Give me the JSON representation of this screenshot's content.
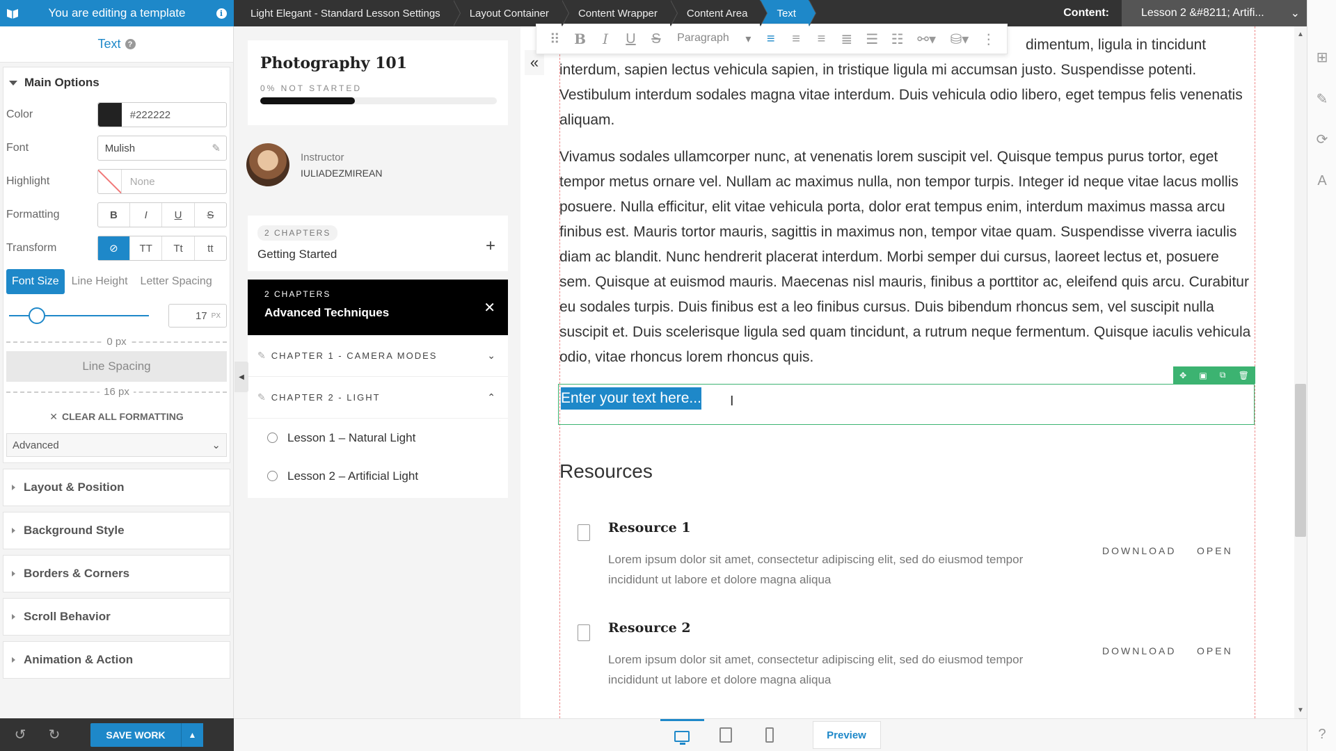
{
  "topbar": {
    "editing_label": "You are editing a template",
    "breadcrumbs": [
      "Light Elegant - Standard Lesson Settings",
      "Layout Container",
      "Content Wrapper",
      "Content Area",
      "Text"
    ],
    "content_label": "Content:",
    "content_value": "Lesson 2 &#8211; Artifi...",
    "accent": "#1e88c9"
  },
  "left_panel": {
    "title": "Text",
    "main_options_label": "Main Options",
    "color_label": "Color",
    "color_value": "#222222",
    "font_label": "Font",
    "font_value": "Mulish",
    "highlight_label": "Highlight",
    "highlight_value": "None",
    "formatting_label": "Formatting",
    "formatting_buttons": [
      "B",
      "I",
      "U",
      "S"
    ],
    "transform_label": "Transform",
    "transform_buttons": [
      "⊘",
      "TT",
      "Tt",
      "tt"
    ],
    "size_tabs": [
      "Font Size",
      "Line Height",
      "Letter Spacing"
    ],
    "font_size_value": "17",
    "font_size_unit": "PX",
    "spacing_top": "0 px",
    "line_spacing_label": "Line Spacing",
    "spacing_bottom": "16 px",
    "clear_formatting": "CLEAR ALL FORMATTING",
    "advanced_label": "Advanced",
    "sections": [
      "Layout & Position",
      "Background Style",
      "Borders & Corners",
      "Scroll Behavior",
      "Animation & Action"
    ],
    "save_label": "SAVE WORK"
  },
  "course": {
    "title": "Photography 101",
    "progress_text": "0% NOT STARTED",
    "progress_fraction": 0.4,
    "instructor_role": "Instructor",
    "instructor_name": "IULIADEZMIREAN",
    "chapter1_count": "2 CHAPTERS",
    "chapter1_name": "Getting Started",
    "chapter2_count": "2 CHAPTERS",
    "chapter2_name": "Advanced Techniques",
    "sub_chapters": [
      "CHAPTER 1 - CAMERA MODES",
      "CHAPTER 2 - LIGHT"
    ],
    "lessons": [
      "Lesson 1 – Natural Light",
      "Lesson 2 – Artificial Light"
    ]
  },
  "editor": {
    "toolbar_paragraph": "Paragraph",
    "para1": "dimentum, ligula in tincidunt interdum, sapien lectus vehicula sapien, in tristique ligula mi accumsan justo. Suspendisse potenti. Vestibulum interdum sodales magna vitae interdum. Duis vehicula odio libero, eget tempus felis venenatis aliquam.",
    "para2": "Vivamus sodales ullamcorper nunc, at venenatis lorem suscipit vel. Quisque tempus purus tortor, eget tempor metus ornare vel. Nullam ac maximus nulla, non tempor turpis. Integer id neque vitae lacus mollis posuere. Nulla efficitur, elit vitae vehicula porta, dolor erat tempus enim, interdum maximus massa arcu finibus est. Mauris tortor mauris, sagittis in maximus non, tempor vitae quam. Suspendisse viverra iaculis diam ac blandit. Nunc hendrerit placerat interdum. Morbi semper dui cursus, laoreet lectus et, posuere sem. Quisque at euismod mauris. Maecenas nisl mauris, finibus a porttitor ac, eleifend quis arcu. Curabitur eu sodales turpis. Duis finibus est a leo finibus cursus. Duis bibendum rhoncus sem, vel suscipit nulla suscipit et. Duis scelerisque ligula sed quam tincidunt, a rutrum neque fermentum. Quisque iaculis vehicula odio, vitae rhoncus lorem rhoncus quis.",
    "placeholder_text": "Enter your text here...",
    "resources_heading": "Resources",
    "resources": [
      {
        "name": "Resource 1",
        "desc": "Lorem ipsum dolor sit amet, consectetur adipiscing elit, sed do eiusmod tempor incididunt ut labore et dolore magna aliqua",
        "download": "DOWNLOAD",
        "open": "OPEN"
      },
      {
        "name": "Resource 2",
        "desc": "Lorem ipsum dolor sit amet, consectetur adipiscing elit, sed do eiusmod tempor incididunt ut labore et dolore magna aliqua",
        "download": "DOWNLOAD",
        "open": "OPEN"
      }
    ]
  },
  "devbar": {
    "preview_label": "Preview"
  }
}
